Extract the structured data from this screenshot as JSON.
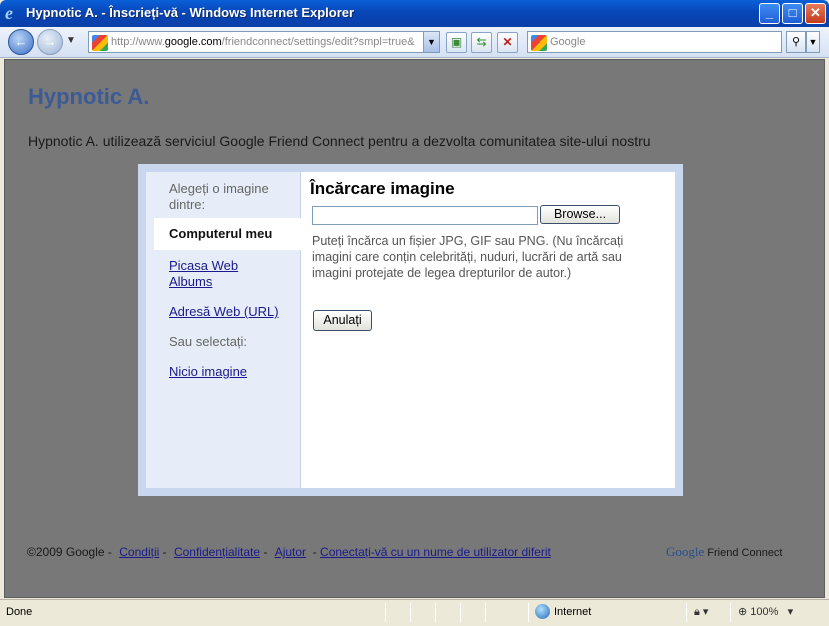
{
  "window": {
    "title": "Hypnotic A. - Înscrieți-vă - Windows Internet Explorer"
  },
  "navbar": {
    "address_prefix": "http://www.",
    "address_domain": "google.com",
    "address_path": "/friendconnect/settings/edit?smpl=true&",
    "search_placeholder": "Google"
  },
  "page": {
    "site_title": "Hypnotic A.",
    "description": "Hypnotic A. utilizează serviciul Google Friend Connect pentru a dezvolta comunitatea site-ului nostru"
  },
  "dialog": {
    "sidebar": {
      "intro": "Alegeți o imagine dintre:",
      "selected": "Computerul meu",
      "picasa": "Picasa Web Albums",
      "url": "Adresă Web (URL)",
      "or_select": "Sau selectați:",
      "no_image": "Nicio imagine"
    },
    "title": "Încărcare imagine",
    "browse_label": "Browse...",
    "help": "Puteți încărca un fișier JPG, GIF sau PNG. (Nu încărcați imagini care conțin celebrități, nuduri, lucrări de artă sau imagini protejate de legea drepturilor de autor.)",
    "cancel_label": "Anulați"
  },
  "footer": {
    "copyright": "©2009 Google -",
    "terms": "Condiții",
    "privacy": "Confidențialitate",
    "help": "Ajutor",
    "switch_user": "Conectați-vă cu un nume de utilizator diferit",
    "brand_logo": "Google",
    "brand_text": "Friend Connect"
  },
  "statusbar": {
    "status": "Done",
    "zone": "Internet",
    "zoom": "100%"
  }
}
